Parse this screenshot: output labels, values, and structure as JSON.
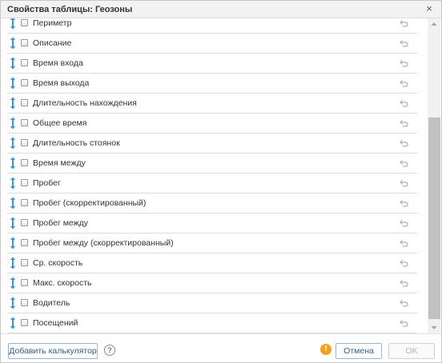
{
  "dialog": {
    "title": "Свойства таблицы: Геозоны",
    "close_glyph": "×"
  },
  "columns": [
    {
      "label": "Периметр",
      "checked": false
    },
    {
      "label": "Описание",
      "checked": false
    },
    {
      "label": "Время входа",
      "checked": false
    },
    {
      "label": "Время выхода",
      "checked": false
    },
    {
      "label": "Длительность нахождения",
      "checked": false
    },
    {
      "label": "Общее время",
      "checked": false
    },
    {
      "label": "Длительность стоянок",
      "checked": false
    },
    {
      "label": "Время между",
      "checked": false
    },
    {
      "label": "Пробег",
      "checked": false
    },
    {
      "label": "Пробег (скорректированный)",
      "checked": false
    },
    {
      "label": "Пробег между",
      "checked": false
    },
    {
      "label": "Пробег между (скорректированный)",
      "checked": false
    },
    {
      "label": "Ср. скорость",
      "checked": false
    },
    {
      "label": "Макс. скорость",
      "checked": false
    },
    {
      "label": "Водитель",
      "checked": false
    },
    {
      "label": "Посещений",
      "checked": false
    }
  ],
  "footer": {
    "add_calculator_label": "Добавить калькулятор",
    "help_glyph": "?",
    "warning_glyph": "!",
    "cancel_label": "Отмена",
    "ok_label": "OK"
  },
  "icons": {
    "drag": "drag-handle-icon",
    "checkbox": "checkbox-icon",
    "reset": "undo-arrow-icon",
    "help": "question-circle-icon",
    "warning": "exclamation-circle-icon"
  },
  "colors": {
    "drag_handle": "#3a94d6",
    "warning": "#f2a21f",
    "button_text": "#2f5f8a",
    "disabled_text": "#b5b5b5"
  }
}
